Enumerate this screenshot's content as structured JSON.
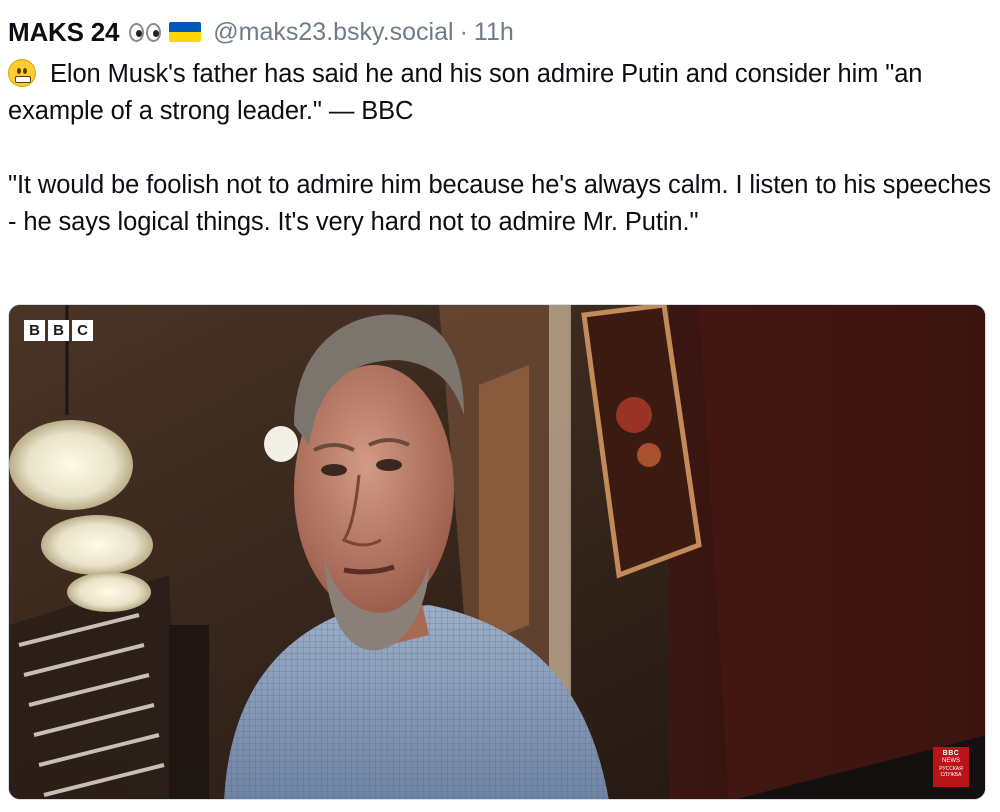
{
  "post": {
    "author": {
      "display_name": "MAKS 24",
      "name_emojis": [
        "eyes-emoji",
        "ukraine-flag-emoji"
      ],
      "handle": "@maks23.bsky.social",
      "separator": "·",
      "timestamp": "11h"
    },
    "text": {
      "lead_emoji": "grimacing-face-emoji",
      "line1": "Elon Musk's father has said he and his son admire Putin and consider him \"an example of a strong leader.\" — BBC",
      "line2": "\"It would be foolish not to admire him because he's always calm. I listen to his speeches - he says logical things. It's very hard not to admire Mr. Putin.\""
    },
    "media": {
      "type": "video-still",
      "corner_logo": [
        "B",
        "B",
        "C"
      ],
      "channel_badge": {
        "brand": "BBC",
        "line1": "NEWS",
        "line2": "РУССКАЯ СЛУЖБА"
      }
    }
  },
  "colors": {
    "text": "#0b0f14",
    "muted": "#6f7c8a",
    "flag_blue": "#0057b7",
    "flag_yellow": "#ffd700",
    "badge_red": "#b8141a"
  }
}
